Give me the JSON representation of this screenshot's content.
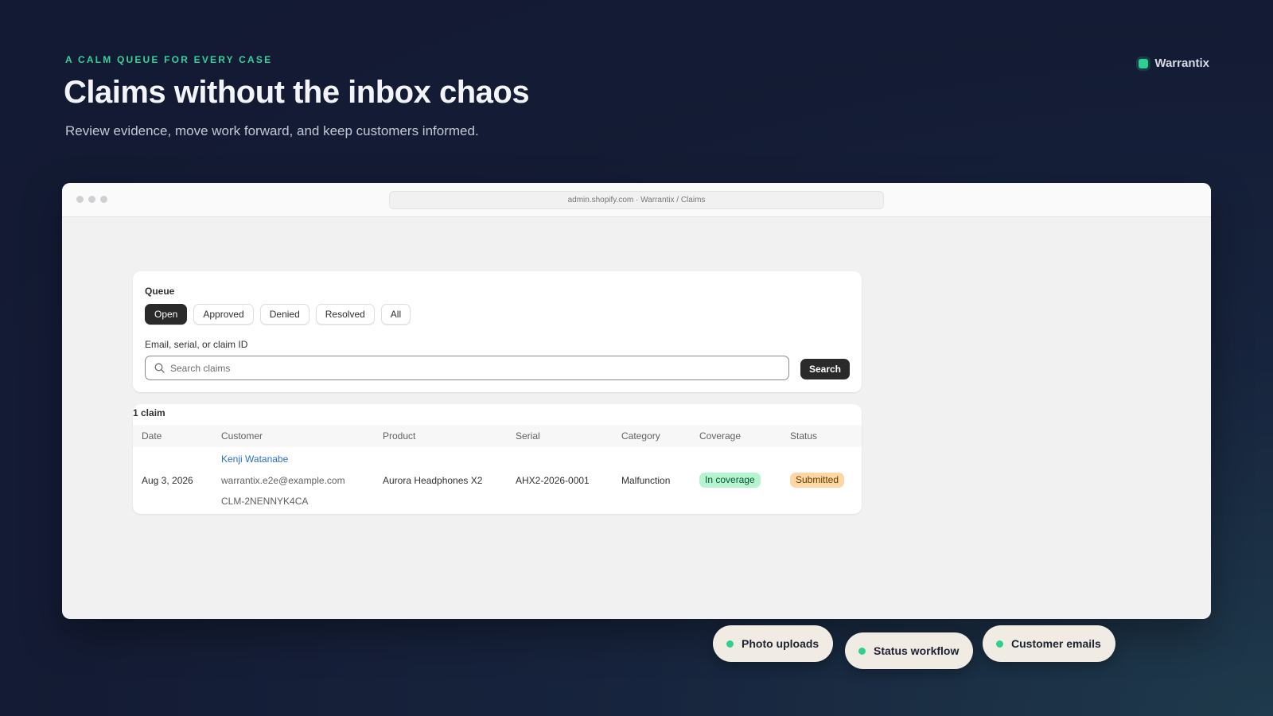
{
  "hero": {
    "eyebrow": "A CALM QUEUE FOR EVERY CASE",
    "title": "Claims without the inbox chaos",
    "subtitle": "Review evidence, move work forward, and keep customers informed."
  },
  "brand": {
    "name": "Warrantix",
    "accent": "#2fd08f"
  },
  "browser": {
    "url": "admin.shopify.com · Warrantix / Claims"
  },
  "queue": {
    "label": "Queue",
    "tabs": [
      {
        "label": "Open",
        "active": true
      },
      {
        "label": "Approved",
        "active": false
      },
      {
        "label": "Denied",
        "active": false
      },
      {
        "label": "Resolved",
        "active": false
      },
      {
        "label": "All",
        "active": false
      }
    ],
    "search_label": "Email, serial, or claim ID",
    "search_placeholder": "Search claims",
    "search_value": "",
    "search_button": "Search"
  },
  "claims": {
    "count_label": "1 claim",
    "columns": [
      "Date",
      "Customer",
      "Product",
      "Serial",
      "Category",
      "Coverage",
      "Status"
    ],
    "rows": [
      {
        "date": "Aug 3, 2026",
        "customer_name": "Kenji Watanabe",
        "customer_email": "warrantix.e2e@example.com",
        "claim_id": "CLM-2NENNYK4CA",
        "product": "Aurora Headphones X2",
        "serial": "AHX2-2026-0001",
        "category": "Malfunction",
        "coverage": "In coverage",
        "status": "Submitted"
      }
    ]
  },
  "features": [
    "Photo uploads",
    "Status workflow",
    "Customer emails"
  ]
}
